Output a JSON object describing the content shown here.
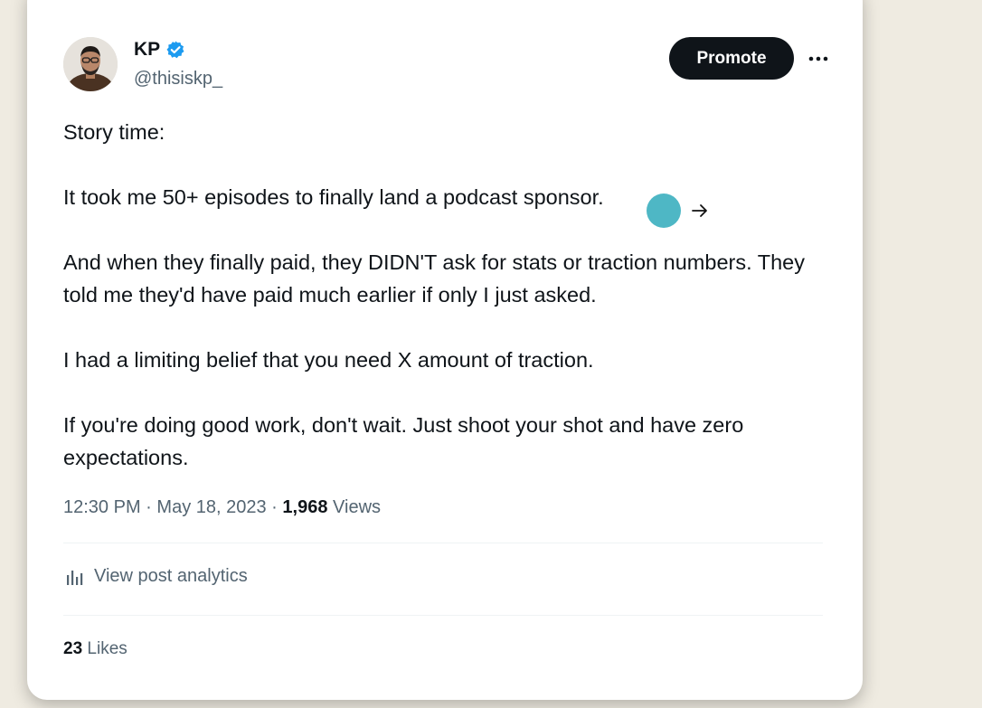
{
  "tweet": {
    "author_name": "KP",
    "handle": "@thisiskp_",
    "promote_label": "Promote",
    "more_label": "···",
    "paragraphs": [
      "Story time:",
      "It took me 50+ episodes to finally land a podcast sponsor.",
      "And when they finally paid, they DIDN'T ask for stats or traction numbers. They told me they'd have paid much earlier if only I just asked.",
      "I had a limiting belief that you need X amount of traction.",
      "If you're doing good work, don't wait. Just shoot your shot and have zero expectations."
    ],
    "time": "12:30 PM",
    "date": "May 18, 2023",
    "views_count": "1,968",
    "views_label": "Views",
    "separator": "·",
    "analytics_label": "View post analytics",
    "likes_count": "23",
    "likes_label": "Likes"
  },
  "colors": {
    "background": "#efebe1",
    "card": "#ffffff",
    "primary_text": "#0f1419",
    "secondary_text": "#536471",
    "verified_blue": "#1d9bf0",
    "promote_bg": "#0f1419",
    "cursor_dot": "#44b3c2"
  },
  "icons": {
    "verified": "verified-badge-icon",
    "more": "more-horizontal-icon",
    "analytics": "bar-chart-icon",
    "cursor": "arrow-right-cursor-icon"
  }
}
